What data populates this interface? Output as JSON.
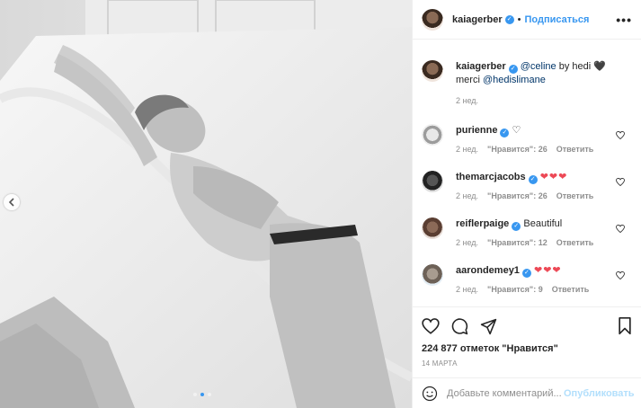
{
  "header": {
    "username": "kaiagerber",
    "separator": "•",
    "follow_label": "Подписаться",
    "more_glyph": "•••"
  },
  "caption": {
    "username": "kaiagerber",
    "mention1": "@celine",
    "text1": " by hedi ",
    "emoji": "🖤",
    "text2": "merci ",
    "mention2": "@hedislimane",
    "time": "2 нед."
  },
  "comments": [
    {
      "username": "purienne",
      "text": "♡",
      "time": "2 нед.",
      "likes": "\"Нравится\": 26",
      "reply": "Ответить"
    },
    {
      "username": "themarcjacobs",
      "text": "❤❤❤",
      "time": "2 нед.",
      "likes": "\"Нравится\": 26",
      "reply": "Ответить"
    },
    {
      "username": "reiflerpaige",
      "text": "Beautiful",
      "time": "2 нед.",
      "likes": "\"Нравится\": 12",
      "reply": "Ответить"
    },
    {
      "username": "aarondemey1",
      "text": "❤❤❤",
      "time": "2 нед.",
      "likes": "\"Нравится\": 9",
      "reply": "Ответить"
    }
  ],
  "stats": {
    "likes_text": "224 877 отметок \"Нравится\"",
    "date": "14 МАРТА"
  },
  "add_comment": {
    "placeholder": "Добавьте комментарий...",
    "publish_label": "Опубликовать"
  },
  "carousel": {
    "current": 2,
    "total": 3
  },
  "colors": {
    "accent": "#3897f0",
    "heart": "#ed4956",
    "text": "#262626",
    "muted": "#8e8e8e"
  }
}
